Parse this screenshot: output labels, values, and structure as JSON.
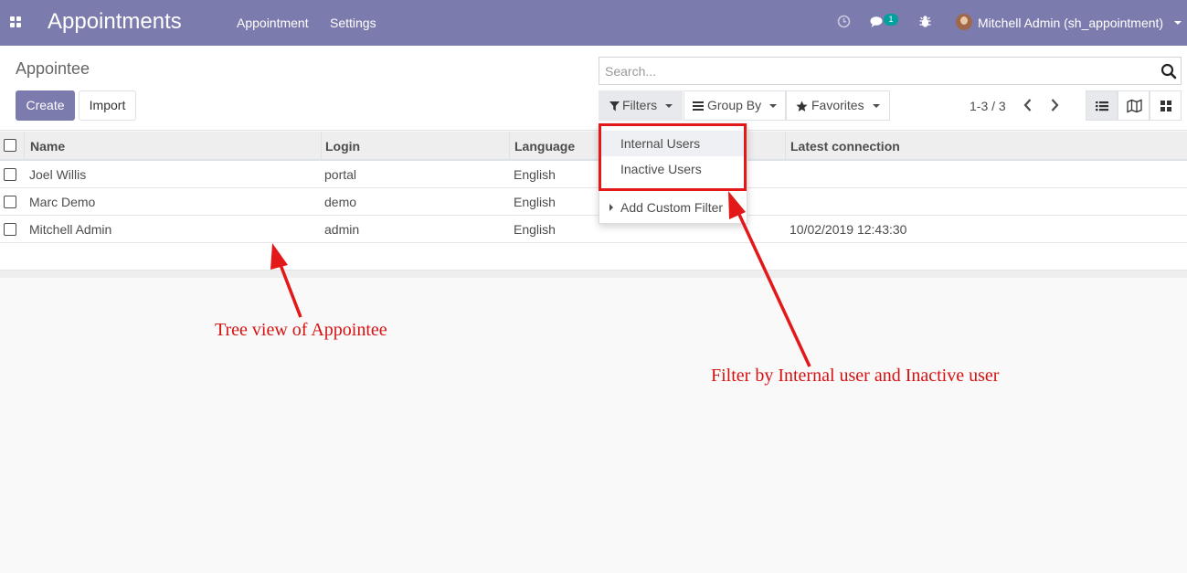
{
  "navbar": {
    "app_title": "Appointments",
    "menus": [
      "Appointment",
      "Settings"
    ],
    "messages_count": "1",
    "user_name": "Mitchell Admin (sh_appointment)",
    "accent_color": "#7c7bad"
  },
  "control_panel": {
    "breadcrumb": "Appointee",
    "create_label": "Create",
    "import_label": "Import",
    "search_placeholder": "Search...",
    "filters_label": "Filters",
    "group_by_label": "Group By",
    "favorites_label": "Favorites",
    "pager_value": "1-3 / 3"
  },
  "filters_dropdown": {
    "items": [
      "Internal Users",
      "Inactive Users"
    ],
    "add_custom_filter": "Add Custom Filter"
  },
  "list": {
    "columns": [
      "Name",
      "Login",
      "Language",
      "Latest connection"
    ],
    "rows": [
      {
        "name": "Joel Willis",
        "login": "portal",
        "language": "English",
        "latest_connection": ""
      },
      {
        "name": "Marc Demo",
        "login": "demo",
        "language": "English",
        "latest_connection": ""
      },
      {
        "name": "Mitchell Admin",
        "login": "admin",
        "language": "English",
        "latest_connection": "10/02/2019 12:43:30"
      }
    ]
  },
  "annotations": {
    "tree_view": "Tree view of Appointee",
    "filter_note": "Filter by Internal user and Inactive user",
    "color": "#e31818"
  }
}
